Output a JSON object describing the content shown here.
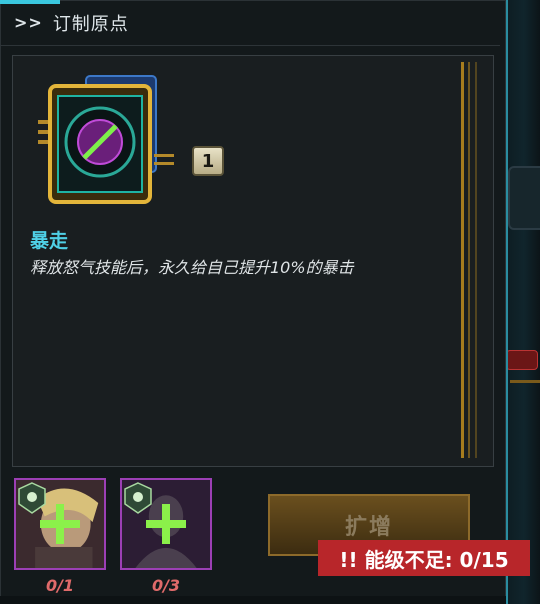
{
  "panel": {
    "chevrons": ">>",
    "title": "订制原点"
  },
  "skill": {
    "name": "暴走",
    "description": "释放怒气技能后，永久给自己提升10%的暴击",
    "level": "1"
  },
  "slots": [
    {
      "count": "0/1"
    },
    {
      "count": "0/3"
    }
  ],
  "actions": {
    "expand_label": "扩增",
    "warning_text": "!! 能级不足: 0/15"
  },
  "colors": {
    "accent_cyan": "#3ac7de",
    "skill_name": "#4fd0e6",
    "slot_border": "#9c3fb5",
    "warning_bg": "#b8262a",
    "gold": "#a67c1e"
  }
}
